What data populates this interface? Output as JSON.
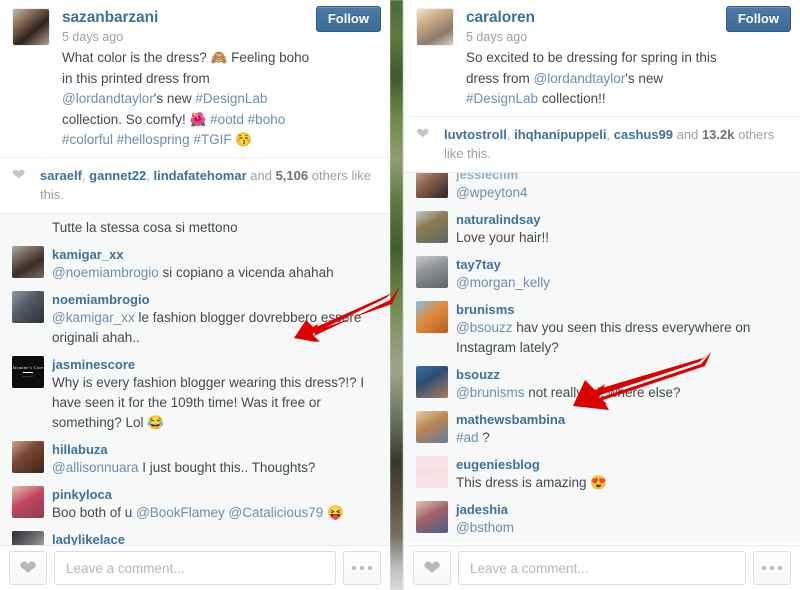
{
  "app": {
    "name": "Instagram post comparison screenshot",
    "accent_blue": "#3f729b",
    "link_blue": "#6b8fae",
    "text_color": "#444a4f",
    "muted_color": "#9ba1a6",
    "arrow_color": "#dd0000",
    "background": "#f7f8f8"
  },
  "left_post": {
    "username": "sazanbarzani",
    "timestamp": "5 days ago",
    "follow_label": "Follow",
    "caption_parts": [
      {
        "t": "What color is the dress? ",
        "k": "text"
      },
      {
        "t": "🙈",
        "k": "emoji"
      },
      {
        "t": " Feeling boho in this printed dress from ",
        "k": "text"
      },
      {
        "t": "@lordandtaylor",
        "k": "link"
      },
      {
        "t": "'s new ",
        "k": "text"
      },
      {
        "t": "#DesignLab",
        "k": "link"
      },
      {
        "t": " collection. So comfy! ",
        "k": "text"
      },
      {
        "t": "🌺",
        "k": "emoji"
      },
      {
        "t": " ",
        "k": "text"
      },
      {
        "t": "#ootd #boho #colorful #hellospring #TGIF",
        "k": "link"
      },
      {
        "t": " 😚",
        "k": "emoji"
      }
    ],
    "likes": {
      "names": [
        "saraelf",
        "gannet22",
        "lindafatehomar"
      ],
      "and": " and ",
      "count": "5,106",
      "suffix": " others like this."
    },
    "comments": [
      {
        "username": "",
        "text": "Tutte la stessa cosa si mettono",
        "avatar": "",
        "continuation": true
      },
      {
        "username": "kamigar_xx",
        "mention": "@noemiambrogio",
        "text": " si copiano a vicenda ahahah",
        "avatar": "av1"
      },
      {
        "username": "noemiambrogio",
        "mention": "@kamigar_xx",
        "text": " le fashion blogger dovrebbero essere originali ahah..",
        "avatar": "av2"
      },
      {
        "username": "jasminescore",
        "mention": "",
        "text": "Why is every fashion blogger wearing this dress?!? I have seen it for the 109th time! Was it free or something? Lol 😂",
        "avatar": "av3"
      },
      {
        "username": "hillabuza",
        "mention": "@allisonnuara",
        "text": " I just bought this.. Thoughts?",
        "avatar": "av4"
      },
      {
        "username": "pinkyloca",
        "mention": "",
        "text": "Boo both of u ",
        "mention2": "@BookFlamey @Catalicious79",
        "text2": " 😝",
        "avatar": "av5"
      },
      {
        "username": "ladylikelace",
        "mention": "",
        "text": "♡♡",
        "avatar": "av6"
      }
    ],
    "compose": {
      "placeholder": "Leave a comment...",
      "heart_icon": "heart-icon",
      "more_icon": "more-options-icon"
    }
  },
  "right_post": {
    "username": "caraloren",
    "timestamp": "5 days ago",
    "follow_label": "Follow",
    "caption_parts": [
      {
        "t": "So excited to be dressing for spring in this dress from ",
        "k": "text"
      },
      {
        "t": "@lordandtaylor",
        "k": "link"
      },
      {
        "t": "'s new ",
        "k": "text"
      },
      {
        "t": "#DesignLab",
        "k": "link"
      },
      {
        "t": " collection!!",
        "k": "text"
      }
    ],
    "likes": {
      "names": [
        "luvtostroll",
        "ihqhanipuppeli",
        "cashus99"
      ],
      "and": " and ",
      "count": "13.2k",
      "suffix": " others like this."
    },
    "comments": [
      {
        "username": "jessiecllm",
        "mention": "@wpeyton4",
        "text": "",
        "avatar": "av7",
        "clipped": true
      },
      {
        "username": "naturalindsay",
        "mention": "",
        "text": "Love your hair!!",
        "avatar": "av8"
      },
      {
        "username": "tay7tay",
        "mention": "@morgan_kelly",
        "text": "",
        "avatar": "av9"
      },
      {
        "username": "brunisms",
        "mention": "@bsouzz",
        "text": " hav you seen this dress everywhere on Instagram lately?",
        "avatar": "av10"
      },
      {
        "username": "bsouzz",
        "mention": "@brunisms",
        "text": " not really lol, where else?",
        "avatar": "av11"
      },
      {
        "username": "mathewsbambina",
        "mention": "#ad",
        "text": " ?",
        "avatar": "av12"
      },
      {
        "username": "eugeniesblog",
        "mention": "",
        "text": "This dress is amazing 😍",
        "avatar": "av13"
      },
      {
        "username": "jadeshia",
        "mention": "@bsthom",
        "text": "",
        "avatar": "av14"
      }
    ],
    "compose": {
      "placeholder": "Leave a comment...",
      "heart_icon": "heart-icon",
      "more_icon": "more-options-icon"
    }
  },
  "annotations": [
    {
      "name": "arrow-pointing-to-jasminescore-comment",
      "color": "#dd0000"
    },
    {
      "name": "arrow-pointing-to-mathewsbambina-comment",
      "color": "#dd0000"
    }
  ]
}
